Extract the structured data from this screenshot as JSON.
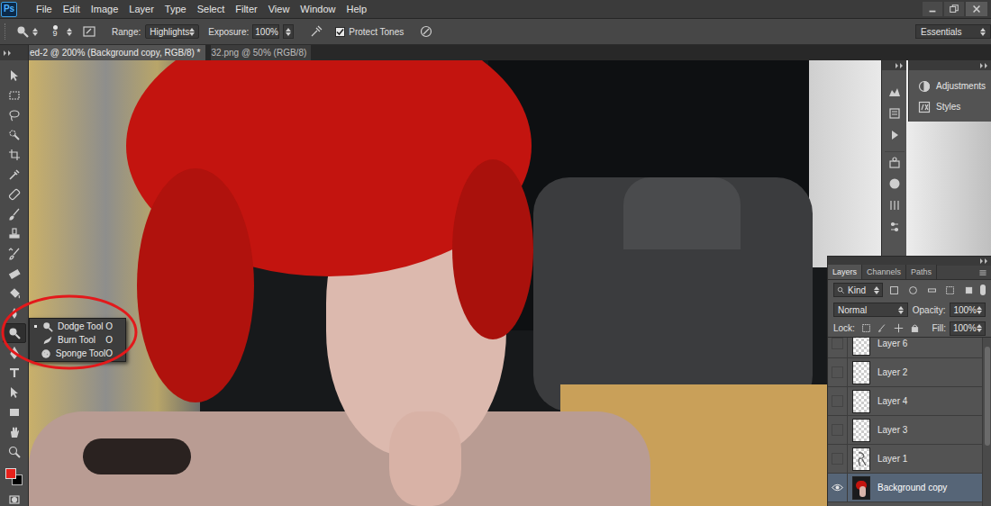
{
  "app": {
    "logo": "Ps"
  },
  "menu": [
    "File",
    "Edit",
    "Image",
    "Layer",
    "Type",
    "Select",
    "Filter",
    "View",
    "Window",
    "Help"
  ],
  "options_bar": {
    "brush_size": "9",
    "range": {
      "label": "Range:",
      "value": "Highlights"
    },
    "exposure": {
      "label": "Exposure:",
      "value": "100%"
    },
    "protect_tones": {
      "label": "Protect Tones",
      "checked": true
    },
    "workspace": "Essentials"
  },
  "document_tabs": [
    {
      "label": "ed-2 @ 200% (Background copy, RGB/8) *",
      "selected": true
    },
    {
      "label": "32.png @ 50% (RGB/8)",
      "selected": false
    }
  ],
  "tool_flyout": {
    "items": [
      {
        "label": "Dodge Tool",
        "shortcut": "O",
        "selected": true
      },
      {
        "label": "Burn Tool",
        "shortcut": "O",
        "selected": false
      },
      {
        "label": "Sponge Tool",
        "shortcut": "O",
        "selected": false
      }
    ]
  },
  "swatches": {
    "foreground": "#e8211b",
    "background": "#000000"
  },
  "panels": [
    {
      "label": "Adjustments"
    },
    {
      "label": "Styles"
    }
  ],
  "layers_panel": {
    "tabs": [
      {
        "label": "Layers",
        "selected": true
      },
      {
        "label": "Channels",
        "selected": false
      },
      {
        "label": "Paths",
        "selected": false
      }
    ],
    "filter": "Kind",
    "blend_mode": "Normal",
    "opacity_label": "Opacity:",
    "opacity": "100%",
    "lock_label": "Lock:",
    "fill_label": "Fill:",
    "fill": "100%",
    "layers": [
      {
        "name": "Layer 6",
        "visible": false,
        "selected": false,
        "kind": "transparent"
      },
      {
        "name": "Layer 2",
        "visible": false,
        "selected": false,
        "kind": "transparent"
      },
      {
        "name": "Layer 4",
        "visible": false,
        "selected": false,
        "kind": "transparent"
      },
      {
        "name": "Layer 3",
        "visible": false,
        "selected": false,
        "kind": "transparent"
      },
      {
        "name": "Layer 1",
        "visible": false,
        "selected": false,
        "kind": "sketch"
      },
      {
        "name": "Background copy",
        "visible": true,
        "selected": true,
        "kind": "photo"
      }
    ]
  }
}
